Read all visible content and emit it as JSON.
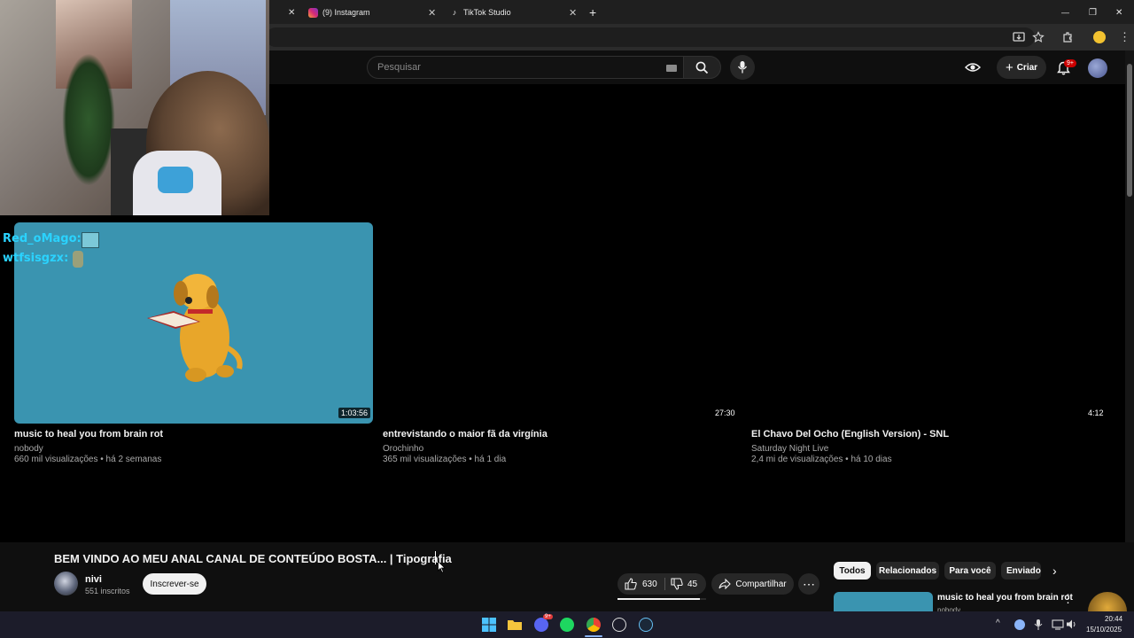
{
  "browser": {
    "tabs": [
      {
        "label": "(9) Instagram"
      },
      {
        "label": "TikTok Studio"
      }
    ],
    "new_tab": "+",
    "window_controls": {
      "minimize": "—",
      "restore": "❐",
      "close": "✕"
    }
  },
  "youtube": {
    "search_placeholder": "Pesquisar",
    "create_label": "Criar",
    "notifications_badge": "9+"
  },
  "overlay_chat": [
    {
      "user": "Red_oMago:",
      "color": "#2ad3ff"
    },
    {
      "user": "wtfsisgzx:",
      "color": "#2ad3ff"
    }
  ],
  "videos": [
    {
      "title": "music to heal you from brain rot",
      "channel": "nobody",
      "meta": "660 mil visualizações • há 2 semanas",
      "duration": "1:03:56"
    },
    {
      "title": "entrevistando o maior fã da virgínia",
      "channel": "Orochinho",
      "meta": "365 mil visualizações • há 1 dia",
      "duration": "27:30"
    },
    {
      "title": "El Chavo Del Ocho (English Version) - SNL",
      "channel": "Saturday Night Live",
      "meta": "2,4 mi de visualizações • há 10 dias",
      "duration": "4:12"
    }
  ],
  "watch": {
    "title": "BEM VINDO AO MEU ANAL CANAL DE CONTEÚDO BOSTA... | Tipografia",
    "channel_name": "nivi",
    "channel_subs": "551 inscritos",
    "subscribe_label": "Inscrever-se",
    "likes": "630",
    "dislikes": "45",
    "share_label": "Compartilhar",
    "chips": [
      "Todos",
      "Relacionados",
      "Para você",
      "Enviados"
    ],
    "sidebar_title": "music to heal you from brain rot",
    "sidebar_channel": "nobody"
  },
  "taskbar": {
    "time": "20:44",
    "date": "15/10/2025",
    "discord_badge": "9+"
  },
  "colors": {
    "accent_red": "#cc0000",
    "thumb_teal": "#3a94b0",
    "chat_name": "#2ad3ff"
  }
}
